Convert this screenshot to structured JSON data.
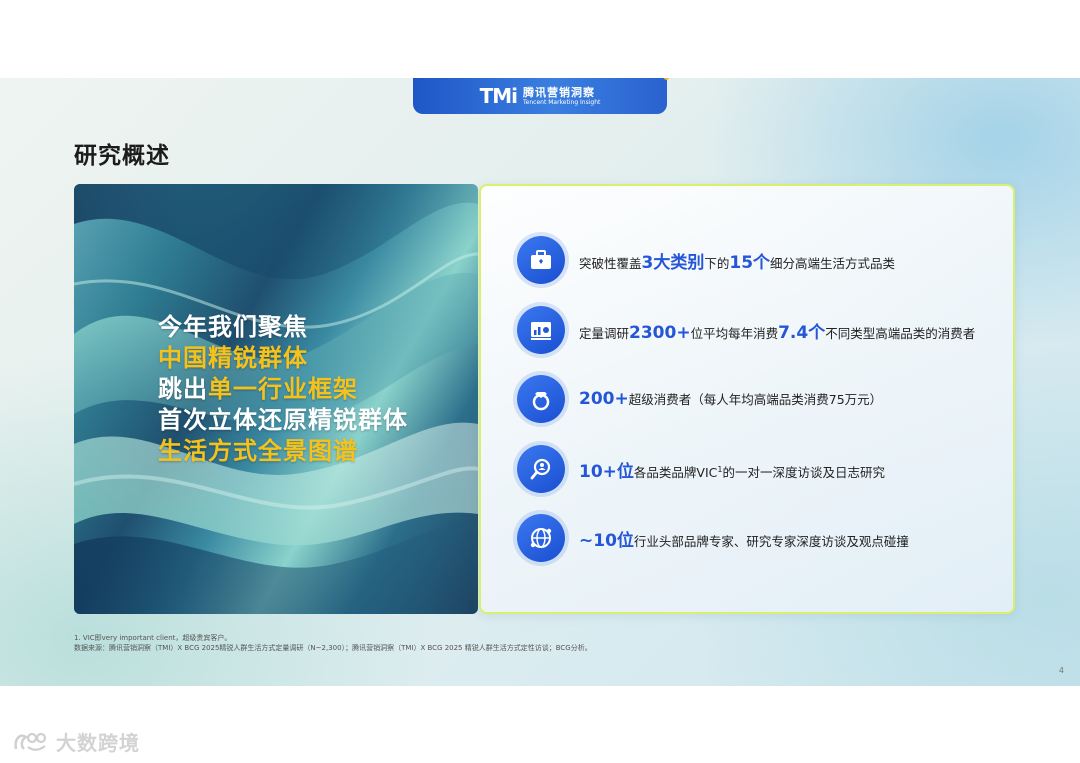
{
  "logo": {
    "mark": "TMi",
    "name_cn": "腾讯营销洞察",
    "name_en": "Tencent Marketing Insight"
  },
  "page_title": "研究概述",
  "hero": {
    "lines": [
      {
        "plain": "今年我们聚焦",
        "highlight": ""
      },
      {
        "plain": "",
        "highlight": "中国精锐群体"
      },
      {
        "plain": "跳出",
        "highlight": "单一行业框架"
      },
      {
        "plain": "首次立体还原精锐群体",
        "highlight": ""
      },
      {
        "plain": "",
        "highlight": "生活方式全景图谱"
      }
    ]
  },
  "items": [
    {
      "icon": "briefcase-icon",
      "prefix": "突破性覆盖",
      "big1": "3大类别",
      "mid": "下的",
      "big2": "15个",
      "suffix": "细分高端生活方式品类"
    },
    {
      "icon": "report-chart-icon",
      "prefix": "定量调研",
      "big1": "2300+",
      "mid": "位平均每年消费",
      "big2": "7.4个",
      "suffix": "不同类型高端品类的消费者"
    },
    {
      "icon": "diamond-ring-icon",
      "prefix": "",
      "big1": "200+",
      "mid": "超级消费者（每人年均高端品类消费75万元）",
      "big2": "",
      "suffix": ""
    },
    {
      "icon": "magnifier-person-icon",
      "prefix": "",
      "big1": "10+位",
      "mid": "各品类品牌VIC",
      "sup": "1",
      "suffix": "的一对一深度访谈及日志研究"
    },
    {
      "icon": "globe-network-icon",
      "prefix": "",
      "big1": "~10位",
      "mid": "行业头部品牌专家、研究专家深度访谈及观点碰撞",
      "big2": "",
      "suffix": ""
    }
  ],
  "footnotes": [
    "1. VIC即very important client，超级贵宾客户。",
    "数据来源：腾讯营销洞察（TMI）X BCG 2025精锐人群生活方式定量调研（N~2,300）；腾讯营销洞察（TMI）X BCG 2025 精锐人群生活方式定性访谈；BCG分析。"
  ],
  "page_number": "4",
  "watermark": "大数跨境",
  "colors": {
    "accent_blue": "#2456d6",
    "highlight_yellow": "#f5c21b",
    "panel_border": "#d8f06c"
  }
}
